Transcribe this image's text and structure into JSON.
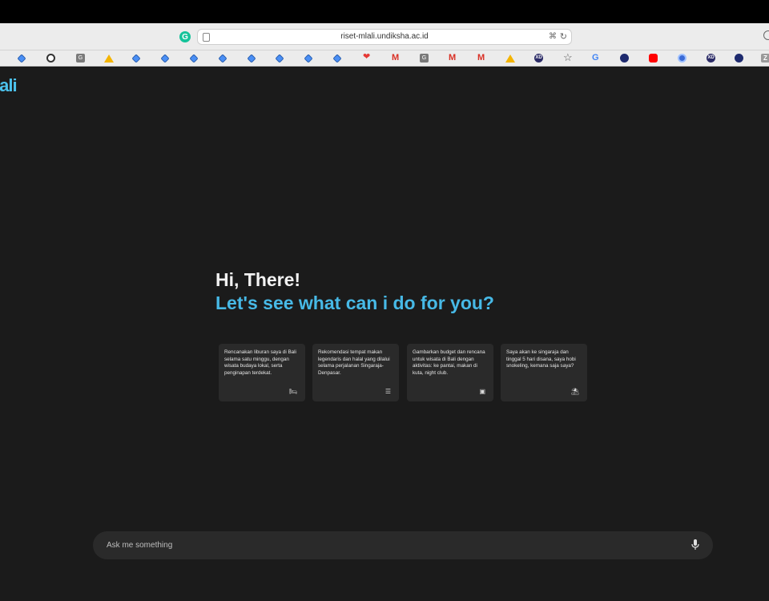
{
  "browser": {
    "url": "riset-mlali.undiksha.ac.id",
    "bookmarks": [
      {
        "icon": "diamond-icon",
        "label": ""
      },
      {
        "icon": "openai-icon",
        "label": ""
      },
      {
        "icon": "grammarly-square-icon",
        "label": "G"
      },
      {
        "icon": "google-drive-icon",
        "label": ""
      },
      {
        "icon": "diamond-icon",
        "label": ""
      },
      {
        "icon": "diamond-icon",
        "label": ""
      },
      {
        "icon": "diamond-icon",
        "label": ""
      },
      {
        "icon": "diamond-icon",
        "label": ""
      },
      {
        "icon": "diamond-icon",
        "label": ""
      },
      {
        "icon": "diamond-icon",
        "label": ""
      },
      {
        "icon": "diamond-icon",
        "label": ""
      },
      {
        "icon": "diamond-icon",
        "label": ""
      },
      {
        "icon": "heart-icon",
        "label": "❤"
      },
      {
        "icon": "gmail-icon",
        "label": "M"
      },
      {
        "icon": "grammarly-square-icon",
        "label": "G"
      },
      {
        "icon": "gmail-icon",
        "label": "M"
      },
      {
        "icon": "gmail-icon",
        "label": "M"
      },
      {
        "icon": "google-drive-icon",
        "label": ""
      },
      {
        "icon": "xd-icon",
        "label": "XD"
      },
      {
        "icon": "star-icon",
        "label": "☆"
      },
      {
        "icon": "google-icon",
        "label": "G"
      },
      {
        "icon": "crest-icon",
        "label": ""
      },
      {
        "icon": "youtube-icon",
        "label": ""
      },
      {
        "icon": "wreath-icon",
        "label": ""
      },
      {
        "icon": "xd-icon",
        "label": "XD"
      },
      {
        "icon": "crest-icon",
        "label": ""
      },
      {
        "icon": "z-square-icon",
        "label": "Z"
      }
    ]
  },
  "app": {
    "logo": "lali",
    "greeting": "Hi, There!",
    "subgreeting": "Let's see what can i do for you?",
    "cards": [
      {
        "text": "Rencanakan liburan saya di Bali selama satu minggu, dengan wisata budaya lokal, serta penginapan terdekat.",
        "icon": "bed-icon",
        "glyph": "🛏"
      },
      {
        "text": "Rekomendasi tempat makan legendaris dan halal yang dilalui selama perjalanan Singaraja-Denpasar.",
        "icon": "list-icon",
        "glyph": "☰"
      },
      {
        "text": "Gambarkan budget dan rencana untuk wisata di Bali dengan aktivitas: ke pantai, makan di kuta, night club.",
        "icon": "money-icon",
        "glyph": "▣"
      },
      {
        "text": "Saya akan ke singaraja dan tinggal 5 hari disana, saya hobi snokeling, kemana saja saya?",
        "icon": "beach-umbrella-icon",
        "glyph": "⛱"
      }
    ],
    "chat": {
      "placeholder": "Ask me something",
      "value": ""
    },
    "accent_color": "#47b9e6"
  }
}
